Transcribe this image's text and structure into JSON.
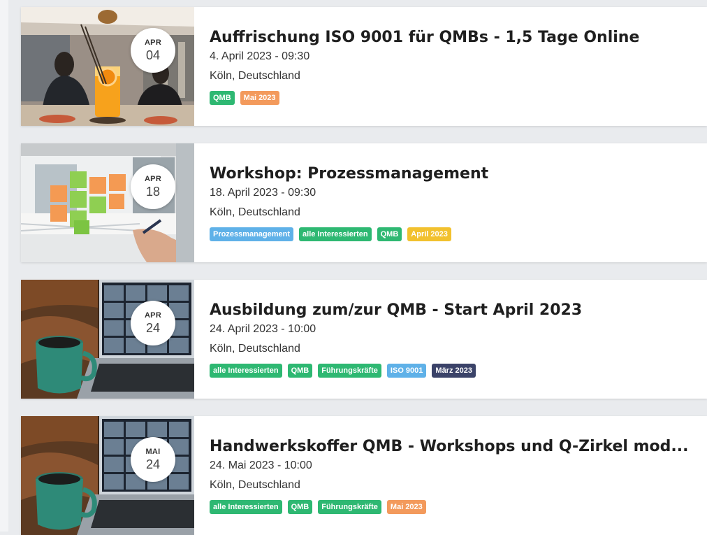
{
  "colors": {
    "QMB": "#2eb872",
    "alle Interessierten": "#2eb872",
    "Führungskräfte": "#2eb872",
    "Prozessmanagement": "#5fb1e8",
    "ISO 9001": "#5fb1e8",
    "Mai 2023": "#f39a5c",
    "April 2023": "#f2c12e",
    "März 2023": "#3b4369"
  },
  "events": [
    {
      "month": "APR",
      "day": "04",
      "title": "Auffrischung ISO 9001 für QMBs - 1,5 Tage Online",
      "datetime": "4. April 2023 - 09:30",
      "location": "Köln, Deutschland",
      "image": "cafe-photo",
      "tags": [
        "QMB",
        "Mai 2023"
      ]
    },
    {
      "month": "APR",
      "day": "18",
      "title": "Workshop: Prozessmanagement",
      "datetime": "18. April 2023 - 09:30",
      "location": "Köln, Deutschland",
      "image": "sticky-notes-photo",
      "tags": [
        "Prozessmanagement",
        "alle Interessierten",
        "QMB",
        "April 2023"
      ]
    },
    {
      "month": "APR",
      "day": "24",
      "title": "Ausbildung zum/zur QMB - Start April 2023",
      "datetime": "24. April 2023 - 10:00",
      "location": "Köln, Deutschland",
      "image": "video-call-photo",
      "tags": [
        "alle Interessierten",
        "QMB",
        "Führungskräfte",
        "ISO 9001",
        "März 2023"
      ]
    },
    {
      "month": "MAI",
      "day": "24",
      "title": "Handwerkskoffer QMB - Workshops und Q-Zirkel mod...",
      "datetime": "24. Mai 2023 - 10:00",
      "location": "Köln, Deutschland",
      "image": "video-call-photo",
      "tags": [
        "alle Interessierten",
        "QMB",
        "Führungskräfte",
        "Mai 2023"
      ]
    }
  ]
}
